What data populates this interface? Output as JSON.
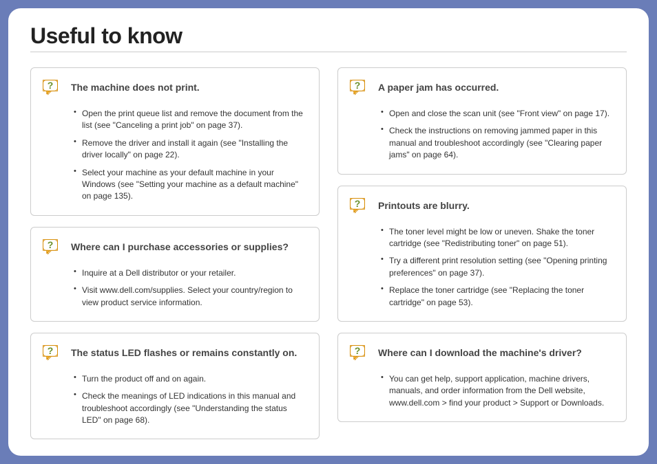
{
  "title": "Useful to know",
  "left": [
    {
      "heading": "The machine does not print.",
      "items": [
        "Open the print queue list and remove the document from the list (see \"Canceling a print job\" on page 37).",
        "Remove the driver and install it again (see \"Installing the driver locally\" on page 22).",
        "Select your machine as your default machine in your Windows (see \"Setting your machine as a default machine\" on page 135)."
      ]
    },
    {
      "heading": "Where can I purchase accessories or supplies?",
      "items": [
        "Inquire at a Dell distributor or your retailer.",
        "Visit www.dell.com/supplies. Select your country/region to view product service information."
      ]
    },
    {
      "heading": "The status LED flashes or remains constantly on.",
      "items": [
        "Turn the product off and on again.",
        "Check the meanings of LED indications in this manual and troubleshoot accordingly (see \"Understanding the status LED\" on page 68)."
      ]
    }
  ],
  "right": [
    {
      "heading": "A paper jam has occurred.",
      "items": [
        "Open and close the scan unit (see \"Front view\" on page 17).",
        "Check the instructions on removing jammed paper in this manual and troubleshoot accordingly (see \"Clearing paper jams\" on page 64)."
      ]
    },
    {
      "heading": "Printouts are blurry.",
      "items": [
        "The toner level might be low or uneven. Shake the toner cartridge (see \"Redistributing toner\" on page 51).",
        "Try a different print resolution setting (see \"Opening printing preferences\" on page 37).",
        "Replace the toner cartridge (see \"Replacing the toner cartridge\" on page 53)."
      ]
    },
    {
      "heading": "Where can I download the machine's driver?",
      "items": [
        "You can get help, support application, machine drivers, manuals, and order information from the Dell website, www.dell.com > find your product > Support or Downloads."
      ]
    }
  ]
}
